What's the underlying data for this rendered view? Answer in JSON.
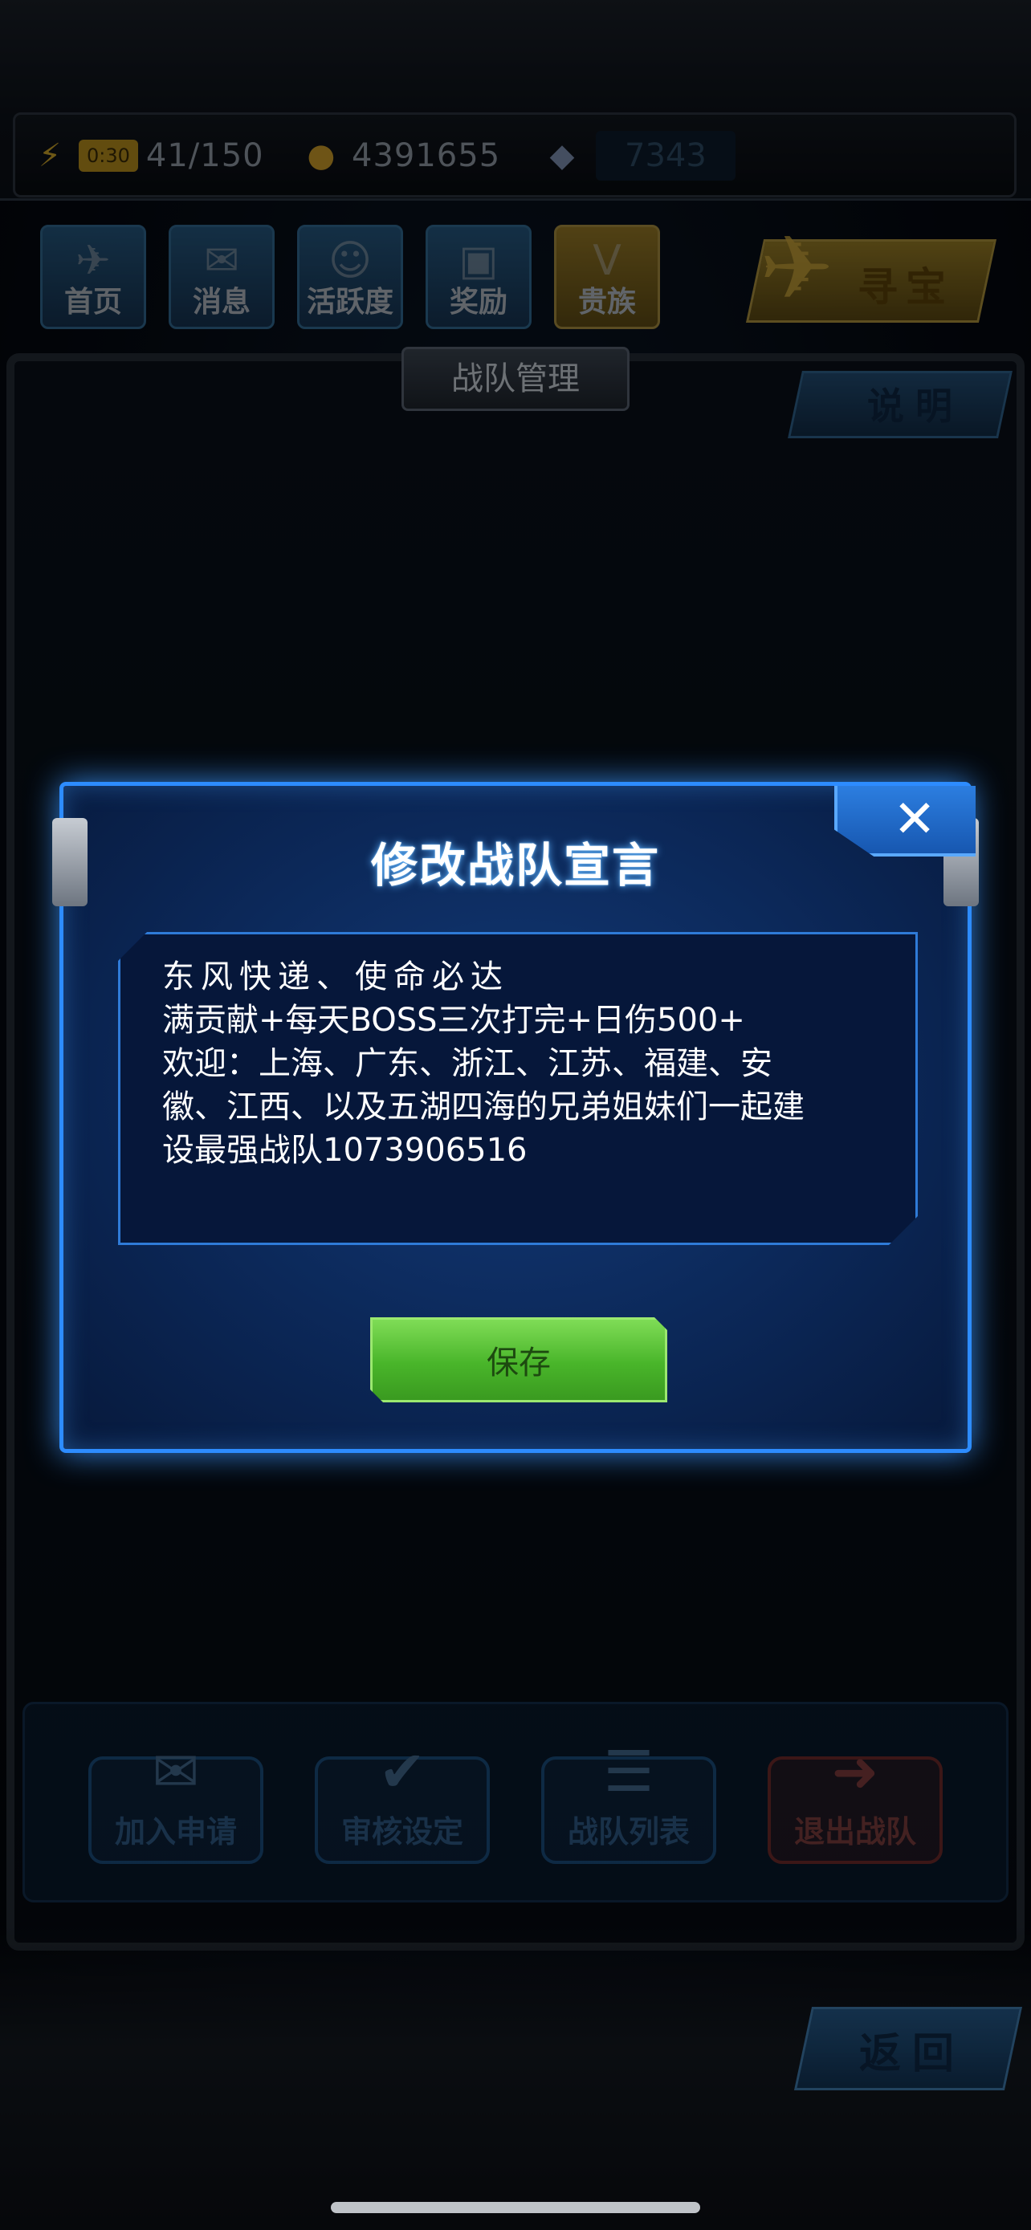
{
  "resources": {
    "stamina_timer": "0:30",
    "stamina": "41/150",
    "gold": "4391655",
    "gems": "7343"
  },
  "top_nav": {
    "home": "首页",
    "messages": "消息",
    "activity": "活跃度",
    "rewards": "奖励",
    "noble": "贵族",
    "treasure": "寻宝"
  },
  "panel": {
    "title": "战队管理",
    "help": "说明"
  },
  "team_actions": {
    "join_requests": "加入申请",
    "review_settings": "审核设定",
    "team_list": "战队列表",
    "leave_team": "退出战队"
  },
  "back_label": "返回",
  "dialog": {
    "title": "修改战队宣言",
    "close_symbol": "✕",
    "declaration_lines": [
      "东风快递、使命必达",
      "满贡献+每天BOSS三次打完+日伤500+",
      "欢迎：上海、广东、浙江、江苏、福建、安",
      "徽、江西、以及五湖四海的兄弟姐妹们一起建",
      "设最强战队1073906516"
    ],
    "save_label": "保存"
  },
  "colors": {
    "dialog_border": "#2d8cff",
    "save_green": "#49b52a",
    "leave_red": "#c0392b"
  }
}
